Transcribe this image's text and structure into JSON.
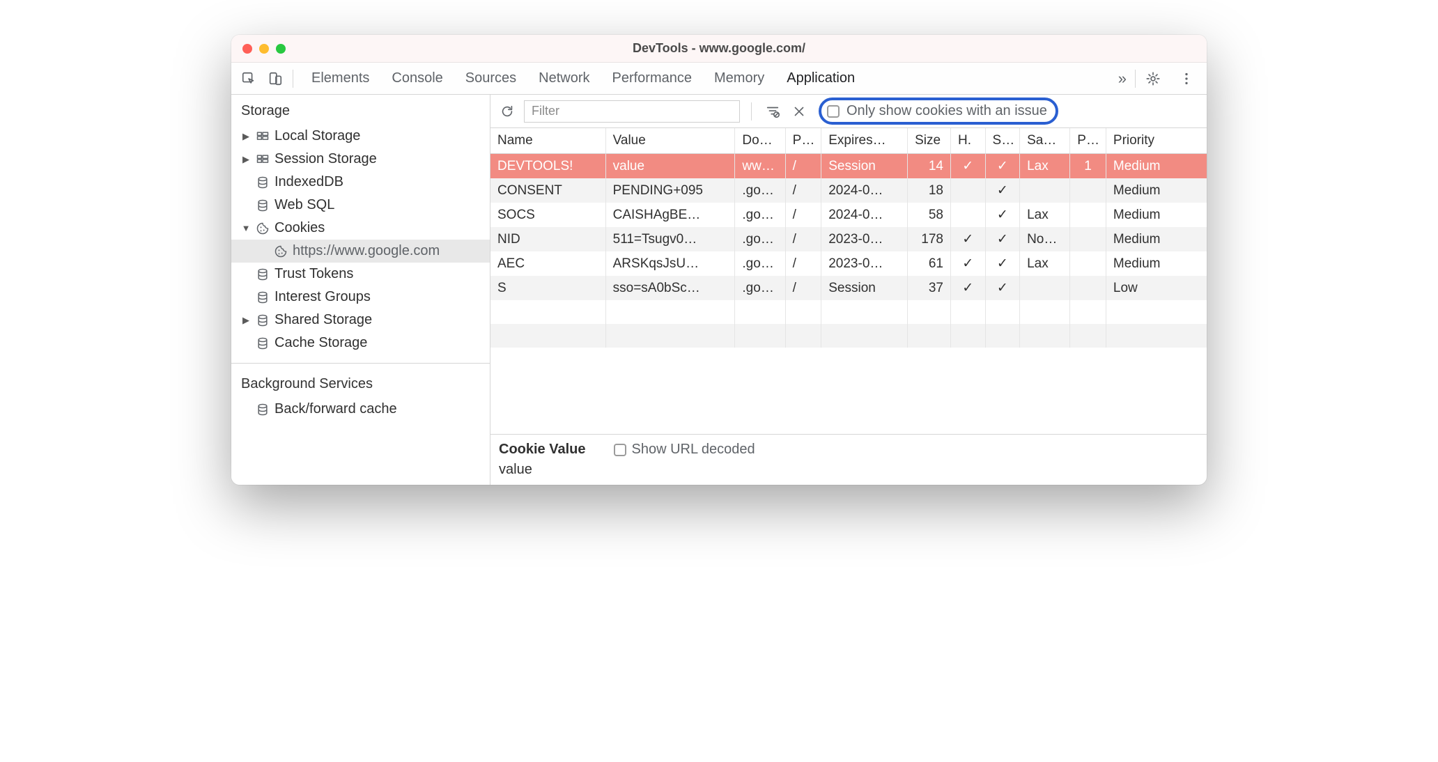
{
  "window": {
    "title": "DevTools - www.google.com/"
  },
  "tabs": {
    "items": [
      "Elements",
      "Console",
      "Sources",
      "Network",
      "Performance",
      "Memory",
      "Application"
    ],
    "active": "Application",
    "more": "»"
  },
  "sidebar": {
    "section1": "Storage",
    "items": [
      {
        "label": "Local Storage",
        "icon": "grid",
        "expandable": true
      },
      {
        "label": "Session Storage",
        "icon": "grid",
        "expandable": true
      },
      {
        "label": "IndexedDB",
        "icon": "db",
        "expandable": false
      },
      {
        "label": "Web SQL",
        "icon": "db",
        "expandable": false
      },
      {
        "label": "Cookies",
        "icon": "cookie",
        "expandable": true,
        "expanded": true,
        "children": [
          {
            "label": "https://www.google.com",
            "icon": "cookie",
            "selected": true
          }
        ]
      },
      {
        "label": "Trust Tokens",
        "icon": "db",
        "expandable": false
      },
      {
        "label": "Interest Groups",
        "icon": "db",
        "expandable": false
      },
      {
        "label": "Shared Storage",
        "icon": "db",
        "expandable": true
      },
      {
        "label": "Cache Storage",
        "icon": "db",
        "expandable": false
      }
    ],
    "section2": "Background Services",
    "bg_items": [
      {
        "label": "Back/forward cache",
        "icon": "db"
      }
    ]
  },
  "toolbar": {
    "filter_placeholder": "Filter",
    "only_show_label": "Only show cookies with an issue"
  },
  "columns": [
    "Name",
    "Value",
    "Do…",
    "P…",
    "Expires…",
    "Size",
    "H.",
    "S…",
    "Sa…",
    "P…",
    "Priority"
  ],
  "rows": [
    {
      "name": "DEVTOOLS!",
      "value": "value",
      "domain": "ww…",
      "path": "/",
      "expires": "Session",
      "size": "14",
      "http": "✓",
      "secure": "✓",
      "samesite": "Lax",
      "partition": "1",
      "priority": "Medium",
      "highlight": true
    },
    {
      "name": "CONSENT",
      "value": "PENDING+095",
      "domain": ".go…",
      "path": "/",
      "expires": "2024-0…",
      "size": "18",
      "http": "",
      "secure": "✓",
      "samesite": "",
      "partition": "",
      "priority": "Medium"
    },
    {
      "name": "SOCS",
      "value": "CAISHAgBE…",
      "domain": ".go…",
      "path": "/",
      "expires": "2024-0…",
      "size": "58",
      "http": "",
      "secure": "✓",
      "samesite": "Lax",
      "partition": "",
      "priority": "Medium"
    },
    {
      "name": "NID",
      "value": "511=Tsugv0…",
      "domain": ".go…",
      "path": "/",
      "expires": "2023-0…",
      "size": "178",
      "http": "✓",
      "secure": "✓",
      "samesite": "No…",
      "partition": "",
      "priority": "Medium"
    },
    {
      "name": "AEC",
      "value": "ARSKqsJsU…",
      "domain": ".go…",
      "path": "/",
      "expires": "2023-0…",
      "size": "61",
      "http": "✓",
      "secure": "✓",
      "samesite": "Lax",
      "partition": "",
      "priority": "Medium"
    },
    {
      "name": "S",
      "value": "sso=sA0bSc…",
      "domain": ".go…",
      "path": "/",
      "expires": "Session",
      "size": "37",
      "http": "✓",
      "secure": "✓",
      "samesite": "",
      "partition": "",
      "priority": "Low"
    }
  ],
  "empty_rows": 2,
  "detail": {
    "label": "Cookie Value",
    "show_decoded_label": "Show URL decoded",
    "value": "value"
  }
}
